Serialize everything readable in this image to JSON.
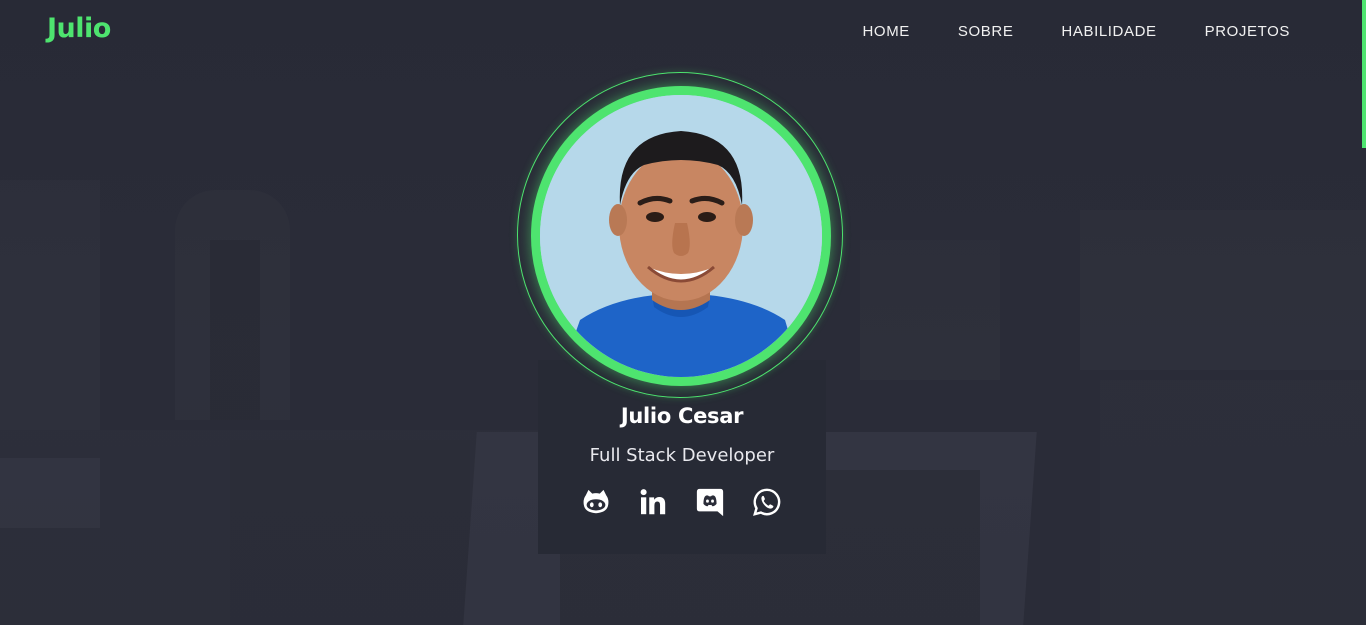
{
  "header": {
    "logo": "Julio",
    "nav": [
      {
        "label": "HOME"
      },
      {
        "label": "SOBRE"
      },
      {
        "label": "HABILIDADE"
      },
      {
        "label": "PROJETOS"
      }
    ]
  },
  "profile": {
    "name": "Julio Cesar",
    "role": "Full Stack Developer",
    "avatar_icon": "profile-photo",
    "social_icons": [
      "github-icon",
      "linkedin-icon",
      "discord-icon",
      "whatsapp-icon"
    ]
  },
  "colors": {
    "accent": "#4ee46f",
    "background": "#2a2c38",
    "text": "#ffffff"
  }
}
